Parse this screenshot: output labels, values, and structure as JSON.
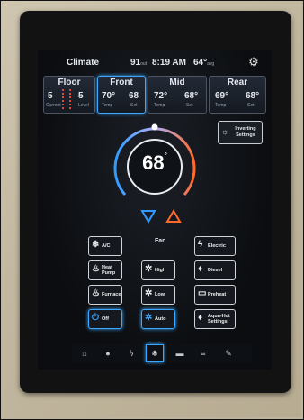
{
  "header": {
    "title": "Climate",
    "outside_temp": "91",
    "outside_temp_unit": "out",
    "time": "8:19 AM",
    "inside_temp": "64",
    "inside_temp_unit": "avg",
    "settings_icon": "gear-icon"
  },
  "zones": [
    {
      "name": "Floor",
      "current": "5",
      "current_label": "Current",
      "set": "5",
      "set_label": "Level",
      "active": false
    },
    {
      "name": "Front",
      "current": "70°",
      "current_label": "Temp",
      "set": "68",
      "set_label": "Set",
      "active": true
    },
    {
      "name": "Mid",
      "current": "72°",
      "current_label": "Temp",
      "set": "68°",
      "set_label": "Set",
      "active": false
    },
    {
      "name": "Rear",
      "current": "69°",
      "current_label": "Temp",
      "set": "68°",
      "set_label": "Set",
      "active": false
    }
  ],
  "thermostat": {
    "setpoint": "68",
    "degree": "°",
    "cool_color": "#2f9bff",
    "heat_color": "#ff6a2a"
  },
  "inverting_button": {
    "label": "Inverting Settings",
    "icon": "sun-icon"
  },
  "fan_label": "Fan",
  "buttons": {
    "ac": {
      "label": "A/C",
      "icon": "snowflake-icon"
    },
    "electric": {
      "label": "Electric",
      "icon": "bolt-icon"
    },
    "heat_pump": {
      "label": "Heat Pump",
      "icon": "flame-icon"
    },
    "fan_high": {
      "label": "High",
      "icon": "fan-icon"
    },
    "diesel": {
      "label": "Diesel",
      "icon": "drop-icon"
    },
    "furnace": {
      "label": "Furnace",
      "icon": "flame-icon"
    },
    "fan_low": {
      "label": "Low",
      "icon": "fan-icon"
    },
    "preheat": {
      "label": "Preheat",
      "icon": "engine-icon"
    },
    "off": {
      "label": "Off",
      "icon": "power-icon"
    },
    "fan_auto": {
      "label": "Auto",
      "icon": "fan-icon"
    },
    "aquahot": {
      "label": "Aqua-Hot Settings",
      "icon": "drop-icon"
    }
  },
  "nav": [
    {
      "name": "home",
      "icon": "home-icon"
    },
    {
      "name": "lighting",
      "icon": "bulb-icon"
    },
    {
      "name": "power",
      "icon": "bolt-icon"
    },
    {
      "name": "climate",
      "icon": "snowflake-icon",
      "selected": true
    },
    {
      "name": "messages",
      "icon": "chat-icon"
    },
    {
      "name": "menu",
      "icon": "list-icon"
    },
    {
      "name": "tools",
      "icon": "wrench-icon"
    }
  ]
}
